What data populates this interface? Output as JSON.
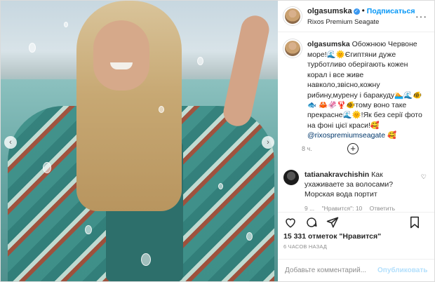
{
  "header": {
    "username": "olgasumska",
    "follow_label": "Подписаться",
    "location": "Rixos Premium Seagate",
    "more_icon": "more-dots-icon"
  },
  "photo": {
    "prev_icon": "chevron-left-icon",
    "next_icon": "chevron-right-icon"
  },
  "caption": {
    "username": "olgasumska",
    "text_1": "Обожнюю Червоне море!🌊🌞Єгиптяни дуже турботливо оберігають кожен корал і все живе навколо,звісно,кожну рибину,мурену і баракуду🏊🌊🐠🐟",
    "text_2": "🦀🦑🦞🐠тому воно таке прекрасне🌊🌞!Як без серії фото на фоні цієї краси!🥰",
    "mention": "@rixospremiumseagate",
    "emoji_end": "🥰",
    "time": "8 ч."
  },
  "comment": {
    "username": "tatianakravchishin",
    "text": "Как ухаживаете за волосами? Морская вода портит",
    "time": "9 ...",
    "likes": "\"Нравится\": 10",
    "reply": "Ответить"
  },
  "actions": {
    "likes_text": "15 331 отметок \"Нравится\"",
    "ago": "6 ЧАСОВ НАЗАД"
  },
  "add_comment": {
    "placeholder": "Добавьте комментарий...",
    "publish": "Опубликовать"
  },
  "colors": {
    "accent": "#0095f6",
    "verified": "#3897f0"
  }
}
